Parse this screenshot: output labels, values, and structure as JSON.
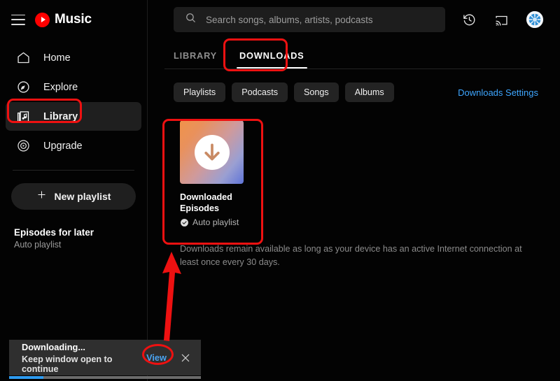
{
  "app": {
    "brand": "Music",
    "brand_color": "#ff0000"
  },
  "sidebar": {
    "menu_icon": "hamburger-icon",
    "items": [
      {
        "label": "Home",
        "icon": "home-icon",
        "active": false
      },
      {
        "label": "Explore",
        "icon": "compass-icon",
        "active": false
      },
      {
        "label": "Library",
        "icon": "library-icon",
        "active": true
      },
      {
        "label": "Upgrade",
        "icon": "circle-play-icon",
        "active": false
      }
    ],
    "new_playlist": {
      "label": "New playlist",
      "icon": "plus-icon"
    },
    "episodes": {
      "title": "Episodes for later",
      "subtitle": "Auto playlist"
    }
  },
  "topbar": {
    "search": {
      "placeholder": "Search songs, albums, artists, podcasts",
      "value": "",
      "icon": "search-icon"
    },
    "history_icon": "history-clock-icon",
    "cast_icon": "cast-icon",
    "avatar": "user-avatar"
  },
  "tabs": [
    {
      "label": "LIBRARY",
      "active": false
    },
    {
      "label": "DOWNLOADS",
      "active": true
    }
  ],
  "filters": {
    "chips": [
      "Playlists",
      "Podcasts",
      "Songs",
      "Albums"
    ],
    "settings_link": "Downloads Settings",
    "link_color": "#3ea6ff"
  },
  "content": {
    "cards": [
      {
        "title": "Downloaded Episodes",
        "subtitle": "Auto playlist",
        "badge_icon": "check-circle-icon",
        "thumb_icon": "download-arrow-icon",
        "gradient_from": "#f0934a",
        "gradient_to": "#5f74d8"
      }
    ],
    "note": "Downloads remain available as long as your device has an active Internet connection at least once every 30 days."
  },
  "notification": {
    "title": "Downloading...",
    "subtitle": "Keep window open to continue",
    "action": "View",
    "action_color": "#4aa3f0",
    "close_icon": "close-icon",
    "progress_percent": 18
  },
  "annotations": {
    "highlight_color": "#ee1111",
    "arrow": "red-arrow-pointing-up"
  }
}
